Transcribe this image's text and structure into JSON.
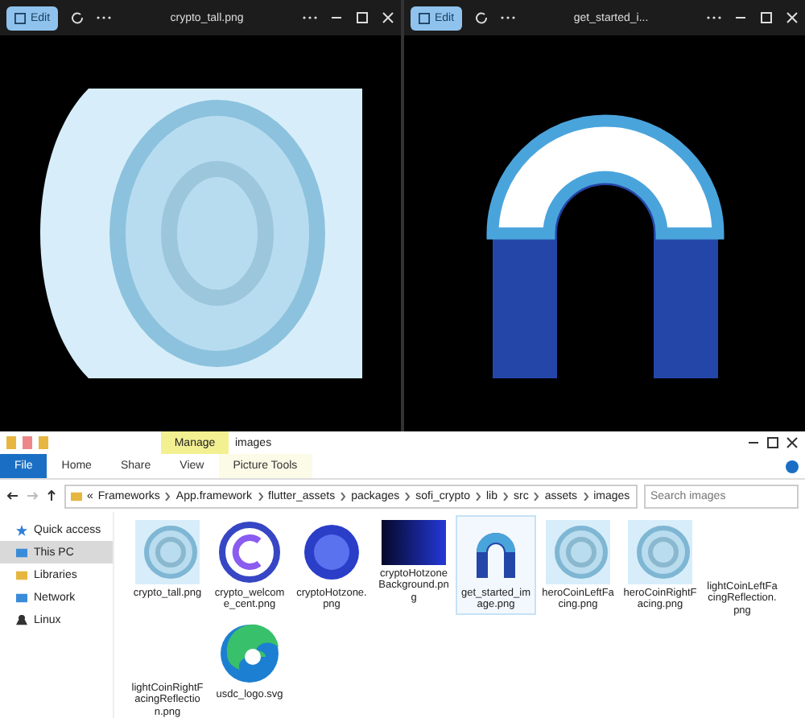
{
  "viewers": [
    {
      "edit_label": "Edit",
      "title": "crypto_tall.png"
    },
    {
      "edit_label": "Edit",
      "title": "get_started_i..."
    }
  ],
  "explorer": {
    "context_tab": "Manage",
    "title": "images",
    "tabs": [
      {
        "label": "File",
        "kind": "file"
      },
      {
        "label": "Home",
        "kind": "plain"
      },
      {
        "label": "Share",
        "kind": "plain"
      },
      {
        "label": "View",
        "kind": "plain"
      },
      {
        "label": "Picture Tools",
        "kind": "context"
      }
    ],
    "address_prefix": "«",
    "path": [
      "Frameworks",
      "App.framework",
      "flutter_assets",
      "packages",
      "sofi_crypto",
      "lib",
      "src",
      "assets",
      "images"
    ],
    "search": {
      "placeholder": "Search images"
    },
    "nav": [
      {
        "label": "Quick access",
        "selected": false
      },
      {
        "label": "This PC",
        "selected": true
      },
      {
        "label": "Libraries",
        "selected": false
      },
      {
        "label": "Network",
        "selected": false
      },
      {
        "label": "Linux",
        "selected": false
      }
    ],
    "files": [
      {
        "name": "crypto_tall.png",
        "selected": false
      },
      {
        "name": "crypto_welcome_cent.png",
        "selected": false
      },
      {
        "name": "cryptoHotzone.png",
        "selected": false
      },
      {
        "name": "cryptoHotzoneBackground.png",
        "selected": false
      },
      {
        "name": "get_started_image.png",
        "selected": true
      },
      {
        "name": "heroCoinLeftFacing.png",
        "selected": false
      },
      {
        "name": "heroCoinRightFacing.png",
        "selected": false
      },
      {
        "name": "lightCoinLeftFacingReflection.png",
        "selected": false
      },
      {
        "name": "lightCoinRightFacingReflection.png",
        "selected": false
      },
      {
        "name": "usdc_logo.svg",
        "selected": false
      }
    ]
  }
}
